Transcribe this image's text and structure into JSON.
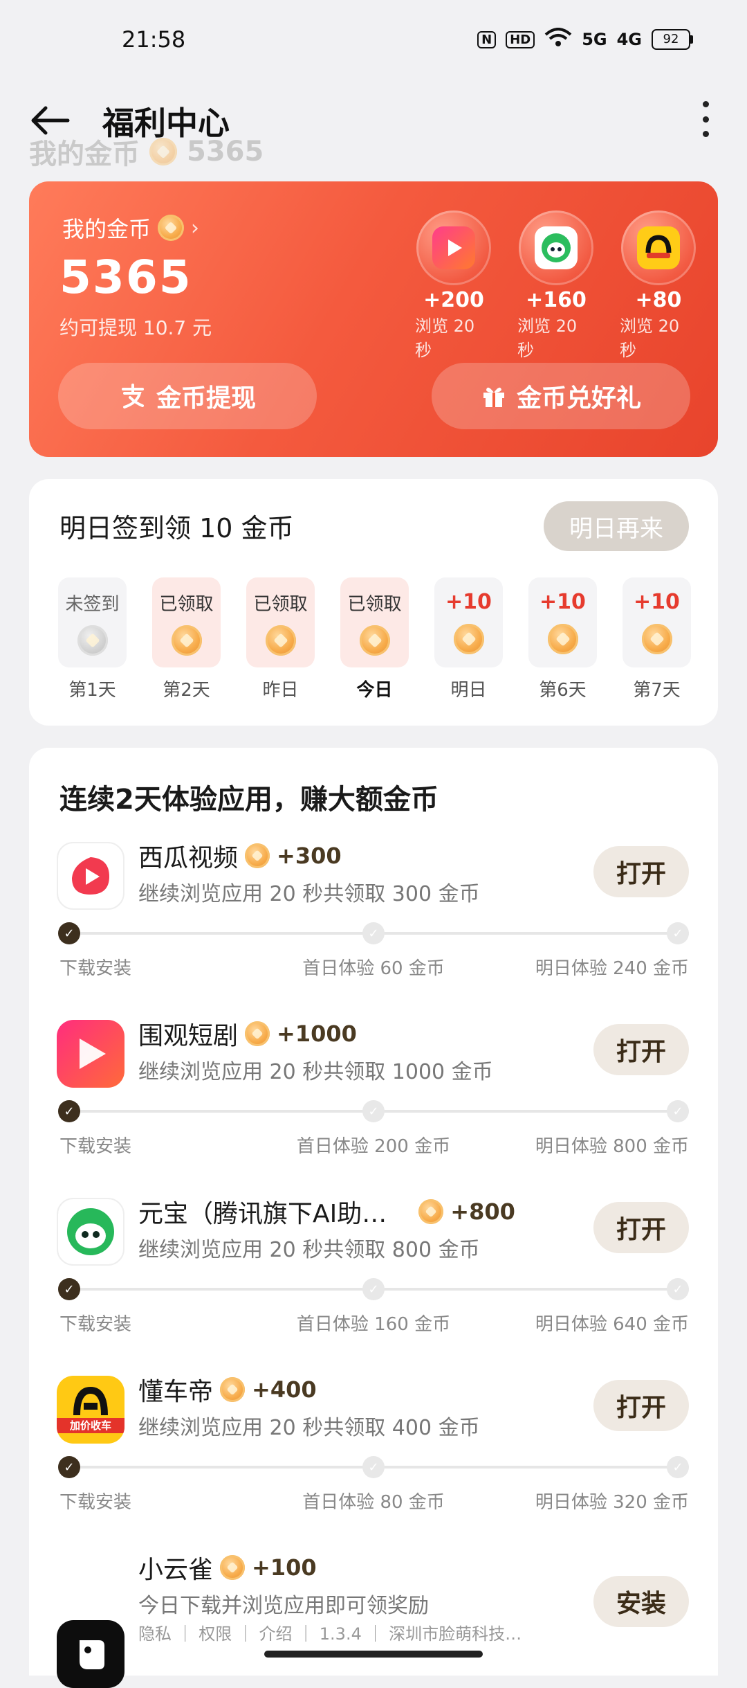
{
  "status": {
    "time": "21:58",
    "nfc": "N",
    "hd": "HD",
    "signal1": "5G",
    "signal2": "4G",
    "battery": "92"
  },
  "header": {
    "title": "福利中心",
    "ghost_label": "我的金币",
    "ghost_amount": "5365"
  },
  "coins": {
    "label": "我的金币",
    "amount": "5365",
    "note": "约可提现 10.7 元",
    "apps": [
      {
        "points": "+200",
        "sub": "浏览 20 秒",
        "icon": "play-icon"
      },
      {
        "points": "+160",
        "sub": "浏览 20 秒",
        "icon": "yuanbao-icon"
      },
      {
        "points": "+80",
        "sub": "浏览 20 秒",
        "icon": "dongchedi-icon"
      }
    ],
    "withdraw_label": "金币提现",
    "gift_label": "金币兑好礼"
  },
  "signin": {
    "title": "明日签到领 10 金币",
    "button": "明日再来",
    "days": [
      {
        "top": "未签到",
        "label": "第1天",
        "state": "missed"
      },
      {
        "top": "已领取",
        "label": "第2天",
        "state": "claimed"
      },
      {
        "top": "已领取",
        "label": "昨日",
        "state": "claimed"
      },
      {
        "top": "已领取",
        "label": "今日",
        "state": "claimed"
      },
      {
        "top": "+10",
        "label": "明日",
        "state": "upcoming"
      },
      {
        "top": "+10",
        "label": "第6天",
        "state": "upcoming"
      },
      {
        "top": "+10",
        "label": "第7天",
        "state": "upcoming"
      }
    ]
  },
  "apps": {
    "title": "连续2天体验应用，赚大额金币",
    "items": [
      {
        "name": "西瓜视频",
        "points": "+300",
        "desc": "继续浏览应用 20 秒共领取 300 金币",
        "button": "打开",
        "s1": "下载安装",
        "s2": "首日体验 60 金币",
        "s3": "明日体验 240 金币"
      },
      {
        "name": "围观短剧",
        "points": "+1000",
        "desc": "继续浏览应用 20 秒共领取 1000 金币",
        "button": "打开",
        "s1": "下载安装",
        "s2": "首日体验 200 金币",
        "s3": "明日体验 800 金币"
      },
      {
        "name": "元宝（腾讯旗下AI助…",
        "points": "+800",
        "desc": "继续浏览应用 20 秒共领取 800 金币",
        "button": "打开",
        "s1": "下载安装",
        "s2": "首日体验 160 金币",
        "s3": "明日体验 640 金币"
      },
      {
        "name": "懂车帝",
        "points": "+400",
        "desc": "继续浏览应用 20 秒共领取 400 金币",
        "button": "打开",
        "s1": "下载安装",
        "s2": "首日体验 80 金币",
        "s3": "明日体验 320 金币",
        "icon_text": "加价收车"
      },
      {
        "name": "小云雀",
        "points": "+100",
        "desc": "今日下载并浏览应用即可领奖励",
        "button": "安装",
        "meta": "隐私 ｜ 权限 ｜ 介绍 ｜ 1.3.4 ｜ 深圳市脸萌科技…"
      }
    ]
  }
}
